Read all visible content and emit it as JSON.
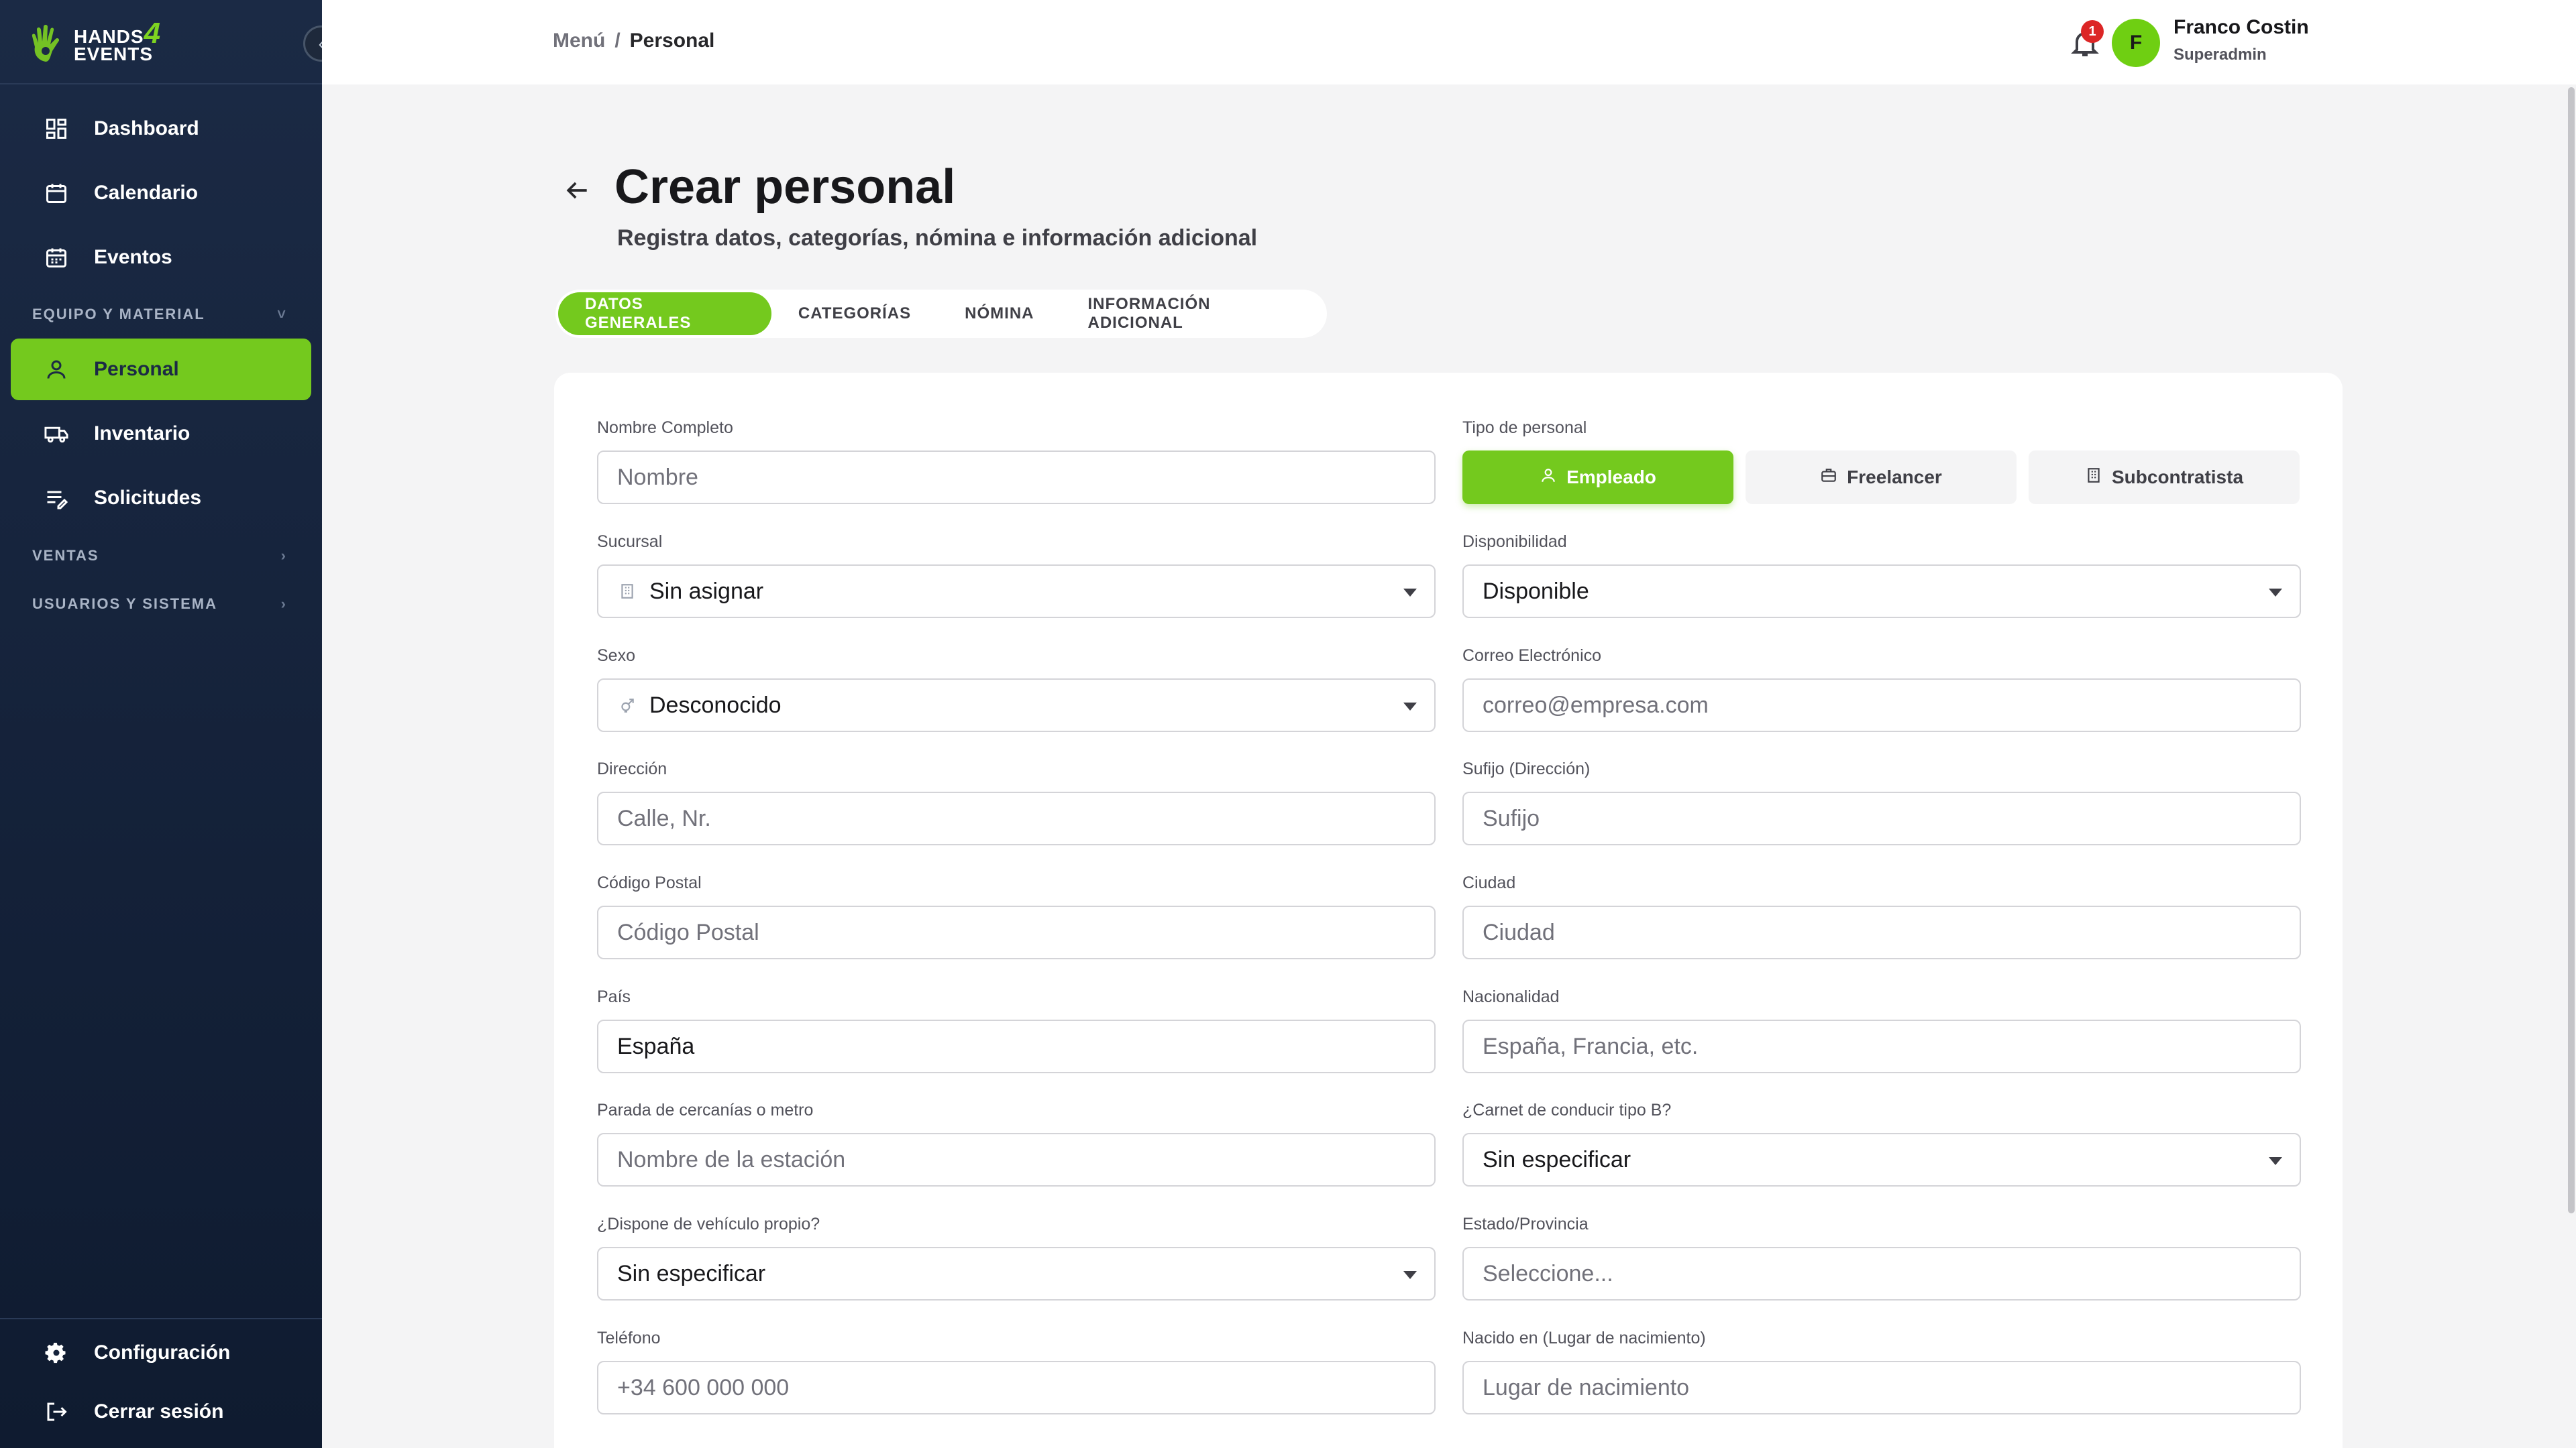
{
  "brand": {
    "line1": "HANDS",
    "four": "4",
    "line2": "EVENTS"
  },
  "sidebar": {
    "items": [
      {
        "label": "Dashboard",
        "icon": "dashboard-icon"
      },
      {
        "label": "Calendario",
        "icon": "calendar-icon"
      },
      {
        "label": "Eventos",
        "icon": "events-icon"
      },
      {
        "label": "Personal",
        "icon": "person-icon",
        "active": true
      },
      {
        "label": "Inventario",
        "icon": "truck-icon"
      },
      {
        "label": "Solicitudes",
        "icon": "requests-icon"
      }
    ],
    "sections": [
      {
        "label": "EQUIPO Y MATERIAL",
        "chevron": "˅"
      },
      {
        "label": "VENTAS",
        "chevron": "›"
      },
      {
        "label": "USUARIOS Y SISTEMA",
        "chevron": "›"
      }
    ],
    "bottom": [
      {
        "label": "Configuración",
        "icon": "gear-icon"
      },
      {
        "label": "Cerrar sesión",
        "icon": "logout-icon"
      }
    ],
    "collapse_glyph": "‹"
  },
  "topbar": {
    "breadcrumb": {
      "root": "Menú",
      "sep": "/",
      "current": "Personal"
    },
    "notifications": "1",
    "user": {
      "initial": "F",
      "name": "Franco Costin",
      "role": "Superadmin"
    }
  },
  "page": {
    "title": "Crear personal",
    "subtitle": "Registra datos, categorías, nómina e información adicional"
  },
  "tabs": [
    "DATOS GENERALES",
    "CATEGORÍAS",
    "NÓMINA",
    "INFORMACIÓN ADICIONAL"
  ],
  "form": {
    "nombre": {
      "label": "Nombre Completo",
      "placeholder": "Nombre"
    },
    "tipo": {
      "label": "Tipo de personal",
      "options": [
        "Empleado",
        "Freelancer",
        "Subcontratista"
      ],
      "selected": "Empleado"
    },
    "sucursal": {
      "label": "Sucursal",
      "value": "Sin asignar"
    },
    "disponibilidad": {
      "label": "Disponibilidad",
      "value": "Disponible"
    },
    "sexo": {
      "label": "Sexo",
      "value": "Desconocido"
    },
    "correo": {
      "label": "Correo Electrónico",
      "placeholder": "correo@empresa.com"
    },
    "direccion": {
      "label": "Dirección",
      "placeholder": "Calle, Nr."
    },
    "sufijo": {
      "label": "Sufijo (Dirección)",
      "placeholder": "Sufijo"
    },
    "cp": {
      "label": "Código Postal",
      "placeholder": "Código Postal"
    },
    "ciudad": {
      "label": "Ciudad",
      "placeholder": "Ciudad"
    },
    "pais": {
      "label": "País",
      "value": "España"
    },
    "nacionalidad": {
      "label": "Nacionalidad",
      "placeholder": "España, Francia, etc."
    },
    "parada": {
      "label": "Parada de cercanías o metro",
      "placeholder": "Nombre de la estación"
    },
    "carnet": {
      "label": "¿Carnet de conducir tipo B?",
      "value": "Sin especificar"
    },
    "vehiculo": {
      "label": "¿Dispone de vehículo propio?",
      "value": "Sin especificar"
    },
    "estado": {
      "label": "Estado/Provincia",
      "placeholder": "Seleccione..."
    },
    "telefono": {
      "label": "Teléfono",
      "placeholder": "+34 600 000 000"
    },
    "nacido": {
      "label": "Nacido en (Lugar de nacimiento)",
      "placeholder": "Lugar de nacimiento"
    }
  },
  "colors": {
    "accent": "#74c91e",
    "sidebar": "#15233b",
    "badge": "#dc2626"
  }
}
